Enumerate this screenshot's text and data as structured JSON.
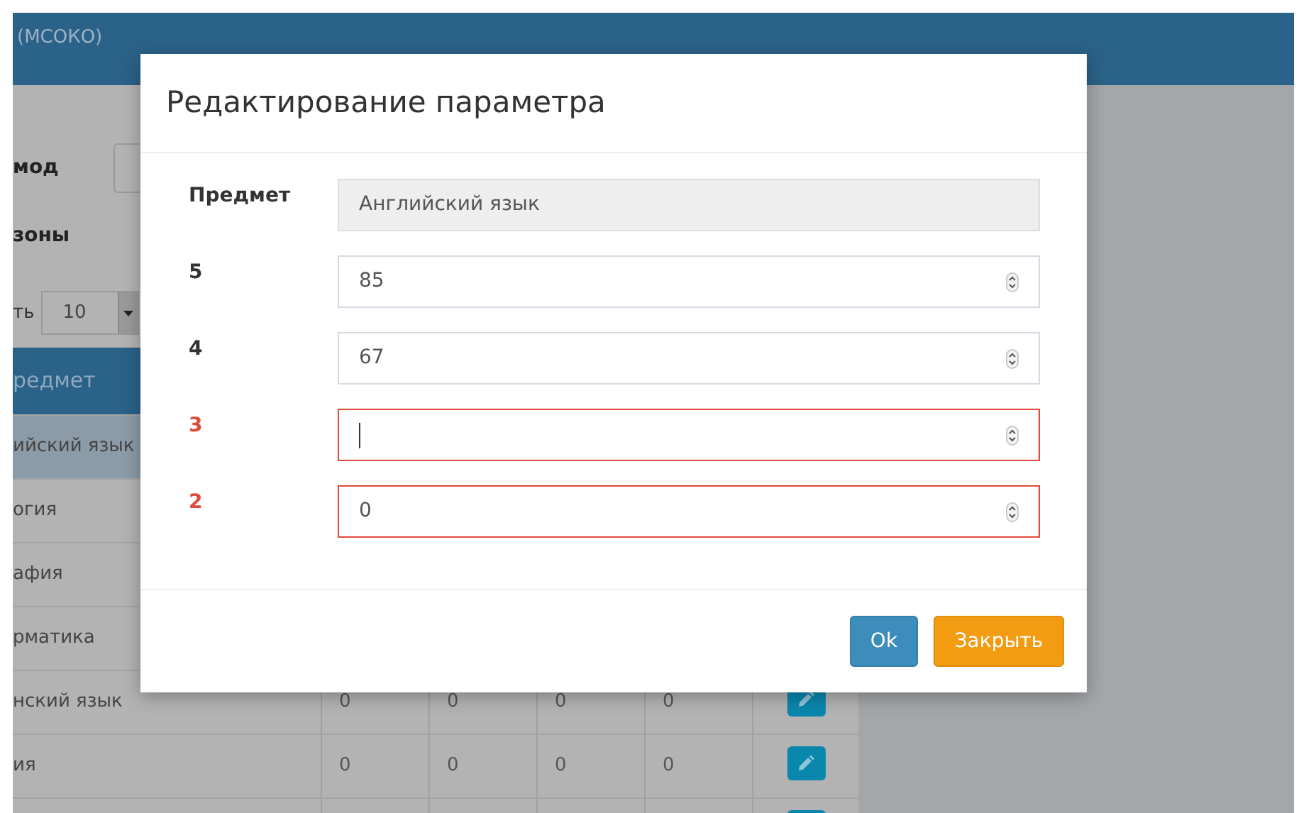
{
  "header": {
    "title": "(МСОКО)"
  },
  "filters": [
    {
      "label": "мод"
    },
    {
      "label": "зоны"
    }
  ],
  "page_size": {
    "label": "ть",
    "value": "10"
  },
  "table": {
    "columns": [
      "редмет"
    ],
    "rows": [
      {
        "subject": "ийский язык",
        "selected": true
      },
      {
        "subject": "огия",
        "selected": false
      },
      {
        "subject": "афия",
        "selected": false
      },
      {
        "subject": "рматика",
        "selected": false
      },
      {
        "subject": "нский язык",
        "selected": false,
        "cells": [
          "0",
          "0",
          "0",
          "0"
        ],
        "editable": true
      },
      {
        "subject": "ия",
        "selected": false,
        "cells": [
          "0",
          "0",
          "0",
          "0"
        ],
        "editable": true
      },
      {
        "selected": false,
        "editable": true
      }
    ]
  },
  "modal": {
    "title": "Редактирование параметра",
    "fields": [
      {
        "label": "Предмет",
        "kind": "readonly",
        "value": "Английский язык"
      },
      {
        "label": "5",
        "kind": "number",
        "value": "85",
        "invalid": false,
        "focused": false
      },
      {
        "label": "4",
        "kind": "number",
        "value": "67",
        "invalid": false,
        "focused": false
      },
      {
        "label": "3",
        "kind": "number",
        "invalid": true,
        "focused": true
      },
      {
        "label": "2",
        "kind": "number",
        "value": "0",
        "invalid": true,
        "focused": false
      }
    ],
    "buttons": [
      {
        "label": "Ok",
        "kind": "primary"
      },
      {
        "label": "Закрыть",
        "kind": "warning"
      }
    ]
  }
}
